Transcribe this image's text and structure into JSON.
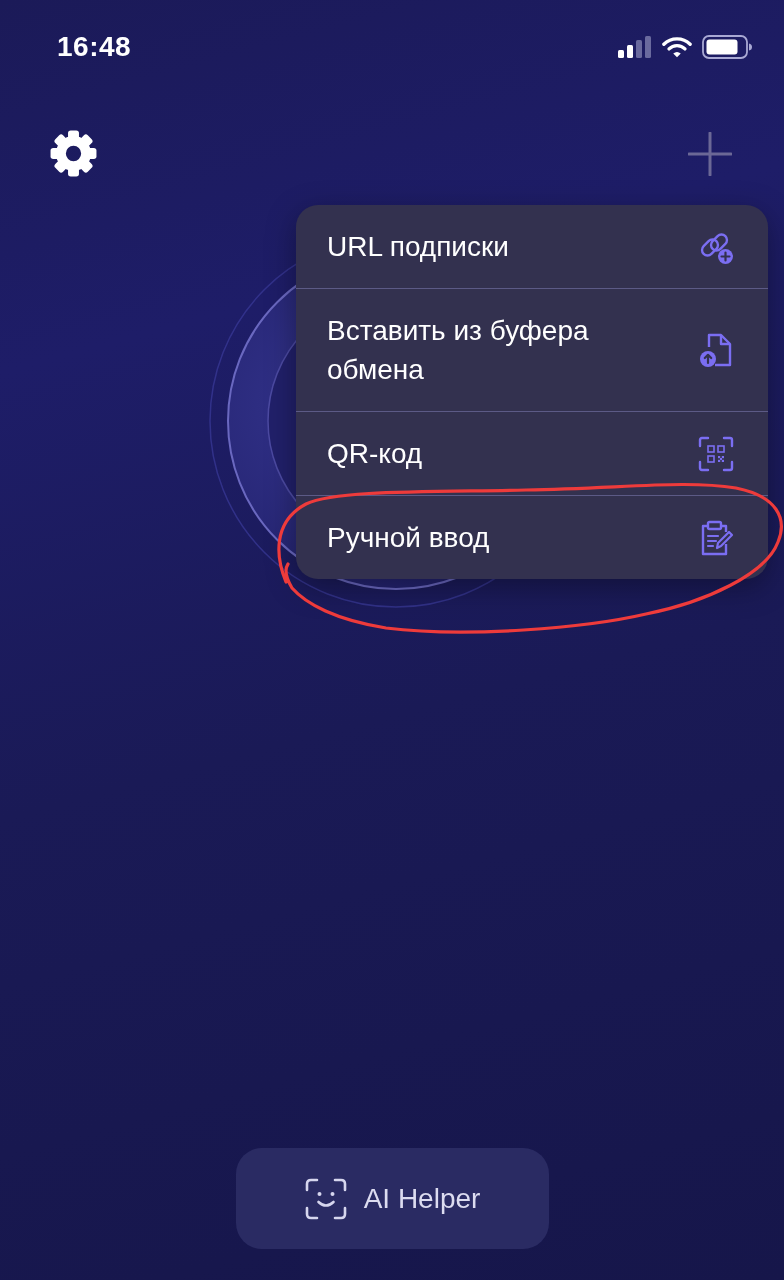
{
  "status_bar": {
    "time": "16:48"
  },
  "menu": {
    "items": [
      {
        "label": "URL подписки",
        "kind": "link-add",
        "circled": false
      },
      {
        "label": "Вставить из буфера обмена",
        "kind": "paste",
        "circled": false
      },
      {
        "label": "QR-код",
        "kind": "qr",
        "circled": false
      },
      {
        "label": "Ручной ввод",
        "kind": "manual",
        "circled": true
      }
    ]
  },
  "ai_button": {
    "label": "AI Helper"
  }
}
